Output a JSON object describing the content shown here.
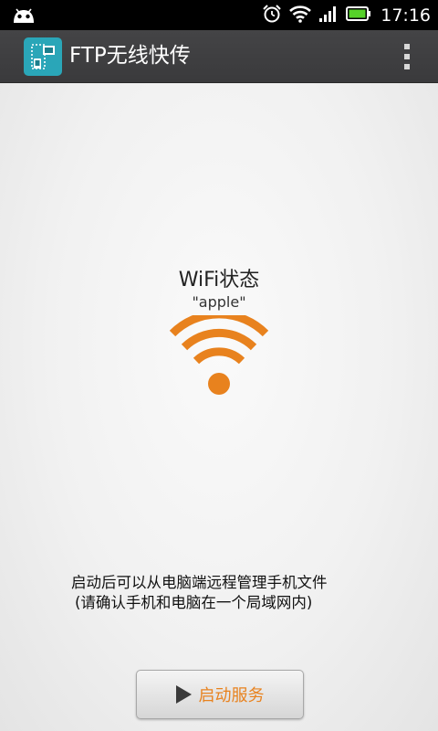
{
  "status_bar": {
    "time": "17:16",
    "icons": [
      "android-debug-icon",
      "alarm-icon",
      "wifi-signal-icon",
      "cell-signal-icon",
      "battery-icon"
    ]
  },
  "action_bar": {
    "title": "FTP无线快传",
    "app_icon": "ftp-app-icon",
    "menu_icon": "overflow-menu-icon"
  },
  "main": {
    "wifi_title": "WiFi状态",
    "wifi_ssid": "\"apple\"",
    "wifi_icon": "wifi-icon",
    "hint_line1": "启动后可以从电脑端远程管理手机文件",
    "hint_line2": "(请确认手机和电脑在一个局域网内)",
    "start_button_label": "启动服务"
  },
  "colors": {
    "accent": "#e8821e",
    "action_bar": "#3f3f41",
    "app_icon": "#2aa6b8"
  }
}
